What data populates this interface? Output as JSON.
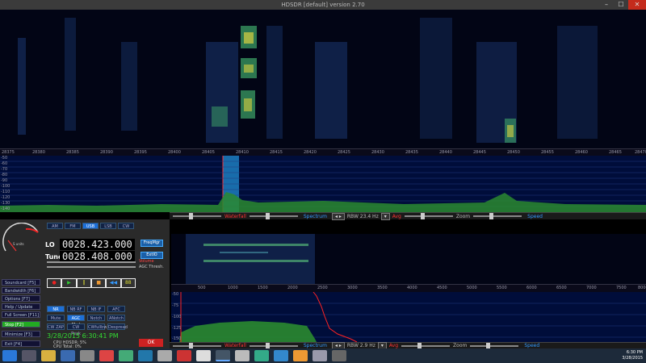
{
  "window": {
    "title": "HDSDR [default]  version 2.70",
    "min": "–",
    "max": "☐",
    "close": "✕"
  },
  "main_axis": {
    "ticks": [
      "28375",
      "28380",
      "28385",
      "28390",
      "28395",
      "28400",
      "28405",
      "28410",
      "28415",
      "28420",
      "28425",
      "28430",
      "28435",
      "28440",
      "28445",
      "28450",
      "28455",
      "28460",
      "28465",
      "28470"
    ]
  },
  "main_spectrum": {
    "dbm": [
      "-50",
      "-60",
      "-70",
      "-80",
      "-90",
      "-100",
      "-110",
      "-120",
      "-130",
      "-140"
    ]
  },
  "top_ctrl": {
    "waterfall": "Waterfall",
    "spectrum": "Spectrum",
    "rbw": "RBW 23.4 Hz",
    "avg": "Avg",
    "zoom": "Zoom",
    "speed": "Speed"
  },
  "bottom_ctrl": {
    "waterfall": "Waterfall",
    "spectrum": "Spectrum",
    "rbw": "RBW 2.9 Hz",
    "avg": "Avg",
    "zoom": "Zoom",
    "speed": "Speed"
  },
  "sub_axis": {
    "ticks": [
      "500",
      "1000",
      "1500",
      "2000",
      "2500",
      "3000",
      "3500",
      "4000",
      "4500",
      "5000",
      "5500",
      "6000",
      "6500",
      "7000",
      "7500",
      "8000"
    ]
  },
  "sub_spectrum": {
    "dbm": [
      "-50",
      "-75",
      "-100",
      "-125",
      "-150"
    ]
  },
  "lo": {
    "label": "LO",
    "value": "0028.423.000"
  },
  "tune": {
    "label": "Tune",
    "value": "0028.408.000"
  },
  "modes": [
    "AM",
    "FM",
    "USB",
    "LSB",
    "CW"
  ],
  "freqmgr": "FreqMgr",
  "extio": "ExtIO",
  "volume": "Volume",
  "agc": "AGC Thresh.",
  "side_buttons": [
    "Soundcard [F5]",
    "Bandwidth [F6]",
    "Options [F7]",
    "Help / Update [F1]",
    "Full Screen [F11]",
    "Stop [F2]",
    "Minimize [F3]",
    "Exit [F4]"
  ],
  "dsp_buttons": [
    "NR",
    "NB RF",
    "NB IF",
    "AFC",
    "Mute",
    "AGC Med",
    "Notch",
    "ANotch",
    "CW ZAP",
    "CW Peak",
    "CWfullbw",
    "Despread"
  ],
  "transport": [
    "●",
    "▶",
    "‖",
    "■",
    "◀◀",
    "88"
  ],
  "clock": "3/28/2015 6:30:41 PM",
  "cpu": {
    "hdsdr": "CPU HDSDR: 5%",
    "total": "CPU Total: 0%"
  },
  "ok": "OK",
  "tray": {
    "time": "6:30 PM",
    "date": "3/28/2015"
  }
}
